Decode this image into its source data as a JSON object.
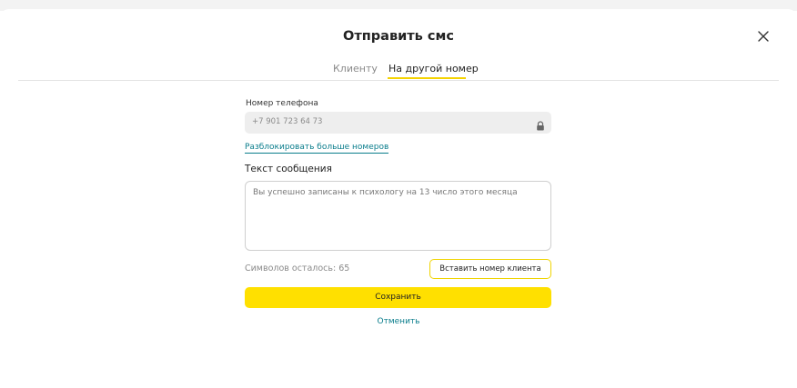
{
  "dialog": {
    "title": "Отправить смс",
    "close_icon": "close-icon"
  },
  "tabs": [
    {
      "label": "Клиенту",
      "active": false
    },
    {
      "label": "На другой номер",
      "active": true
    }
  ],
  "phone": {
    "label": "Номер телефона",
    "value": "+7 901 723 64 73",
    "locked": true,
    "lock_icon": "lock-icon"
  },
  "unlock_link": "Разблокировать больше номеров",
  "message": {
    "label": "Текст сообщения",
    "value": "Вы успешно записаны к психологу на 13 число этого месяца"
  },
  "chars_left": "Символов осталось: 65",
  "buttons": {
    "insert_client_number": "Вставить номер клиента",
    "save": "Сохранить",
    "cancel": "Отменить"
  },
  "colors": {
    "accent_yellow": "#ffe000",
    "link_teal": "#0a7d8c"
  }
}
